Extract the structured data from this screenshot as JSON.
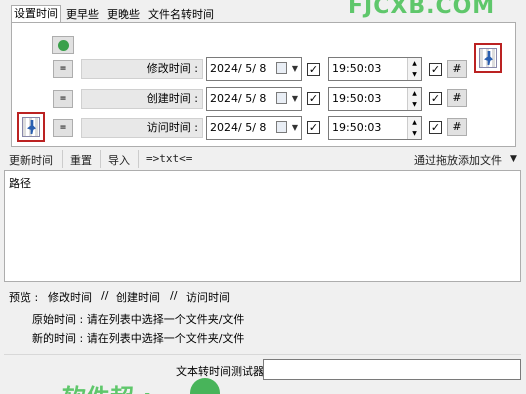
{
  "tabs": [
    "设置时间",
    "更早些",
    "更晚些",
    "文件名转时间"
  ],
  "active_tab": 0,
  "rows": [
    {
      "button": "=",
      "label": "修改时间 :",
      "date": "2024/  5/  8",
      "date_checked": true,
      "time": "19:50:03",
      "time_checked": true,
      "hash": "#"
    },
    {
      "button": "=",
      "label": "创建时间 :",
      "date": "2024/  5/  8",
      "date_checked": true,
      "time": "19:50:03",
      "time_checked": true,
      "hash": "#"
    },
    {
      "button": "=",
      "label": "访问时间 :",
      "date": "2024/  5/  8",
      "date_checked": true,
      "time": "19:50:03",
      "time_checked": true,
      "hash": "#"
    }
  ],
  "toolbar": {
    "update_time": "更新时间",
    "reset": "重置",
    "import": "导入",
    "to_txt": "=>txt<=",
    "drag_add": "通过拖放添加文件",
    "dropdown_glyph": "▼"
  },
  "list": {
    "header": "路径"
  },
  "preview": {
    "prefix": "预览 :",
    "modified": "修改时间",
    "sep1": "//",
    "created": "创建时间",
    "sep2": "//",
    "accessed": "访问时间"
  },
  "info": {
    "original": "原始时间 : 请在列表中选择一个文件夹/文件",
    "new": "新的时间 : 请在列表中选择一个文件夹/文件"
  },
  "tester": {
    "label": "文本转时间测试器",
    "value": ""
  },
  "watermark": {
    "top": "FJCXB.COM",
    "bottom": "软件超 :"
  },
  "checkmark": "✓",
  "spin_up": "▲",
  "spin_down": "▼",
  "colors": {
    "accent_green": "#5fc76b",
    "icon_red": "#b22222"
  }
}
